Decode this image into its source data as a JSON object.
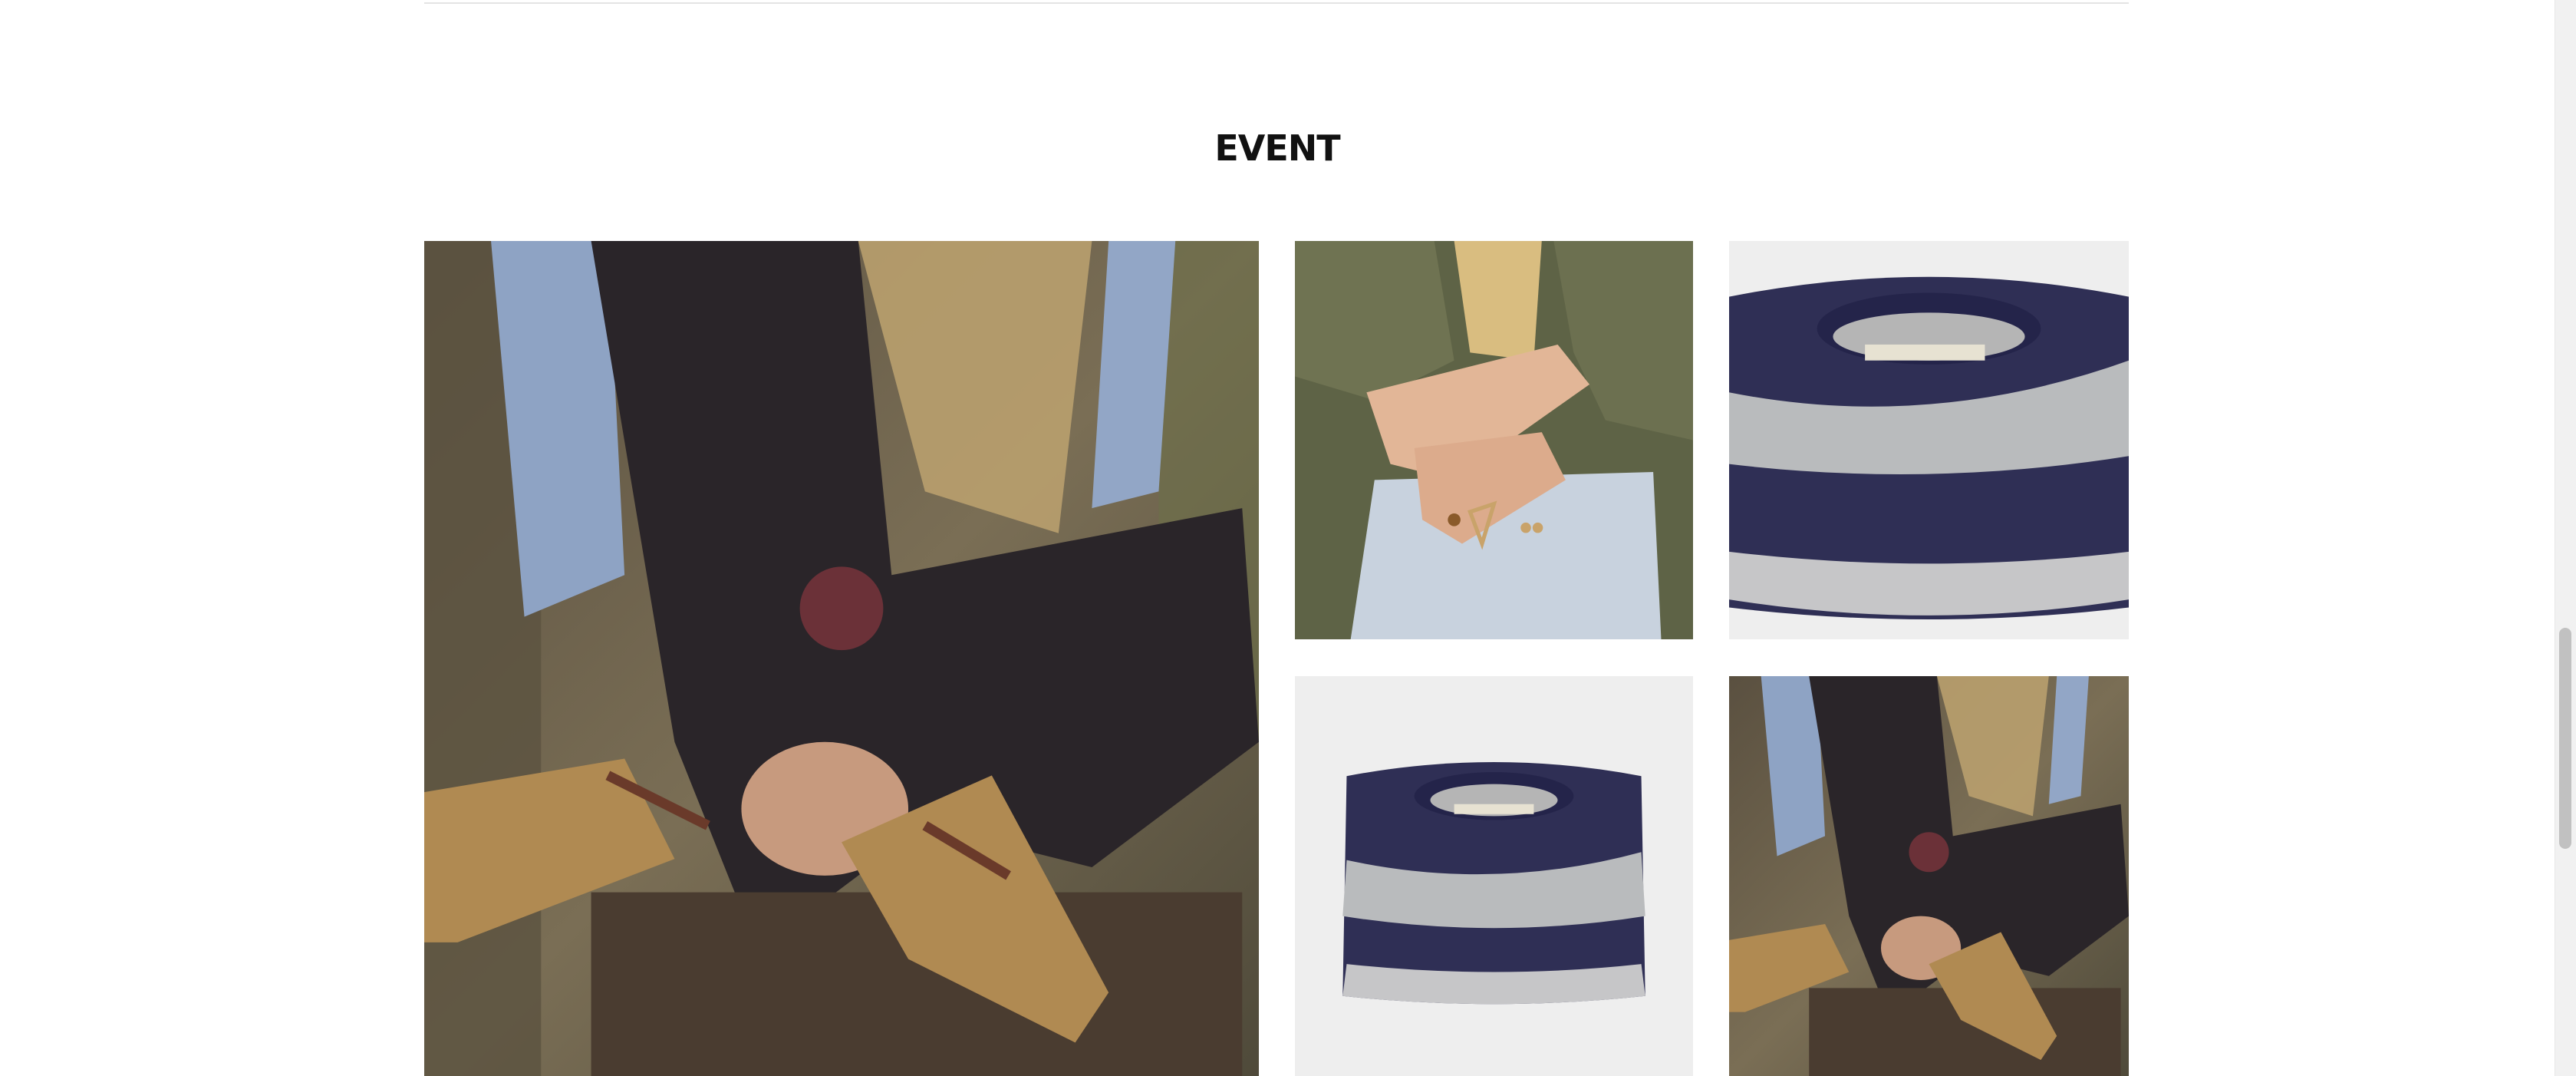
{
  "section": {
    "title": "EVENT"
  },
  "gallery": {
    "tiles": [
      {
        "icon": "photo-woman-sitting-boots-watch"
      },
      {
        "icon": "photo-hands-rings-knit-sleeves"
      },
      {
        "icon": "photo-striped-sweater-folded"
      },
      {
        "icon": "photo-striped-sweater-folded"
      },
      {
        "icon": "photo-woman-sitting-boots-watch"
      }
    ]
  },
  "colors": {
    "background": "#ffffff",
    "title": "#111111",
    "divider": "#e4e4e4",
    "navy": "#2f2f55",
    "grey_stripe": "#b9bbbd",
    "boot_tan": "#b08a52"
  }
}
